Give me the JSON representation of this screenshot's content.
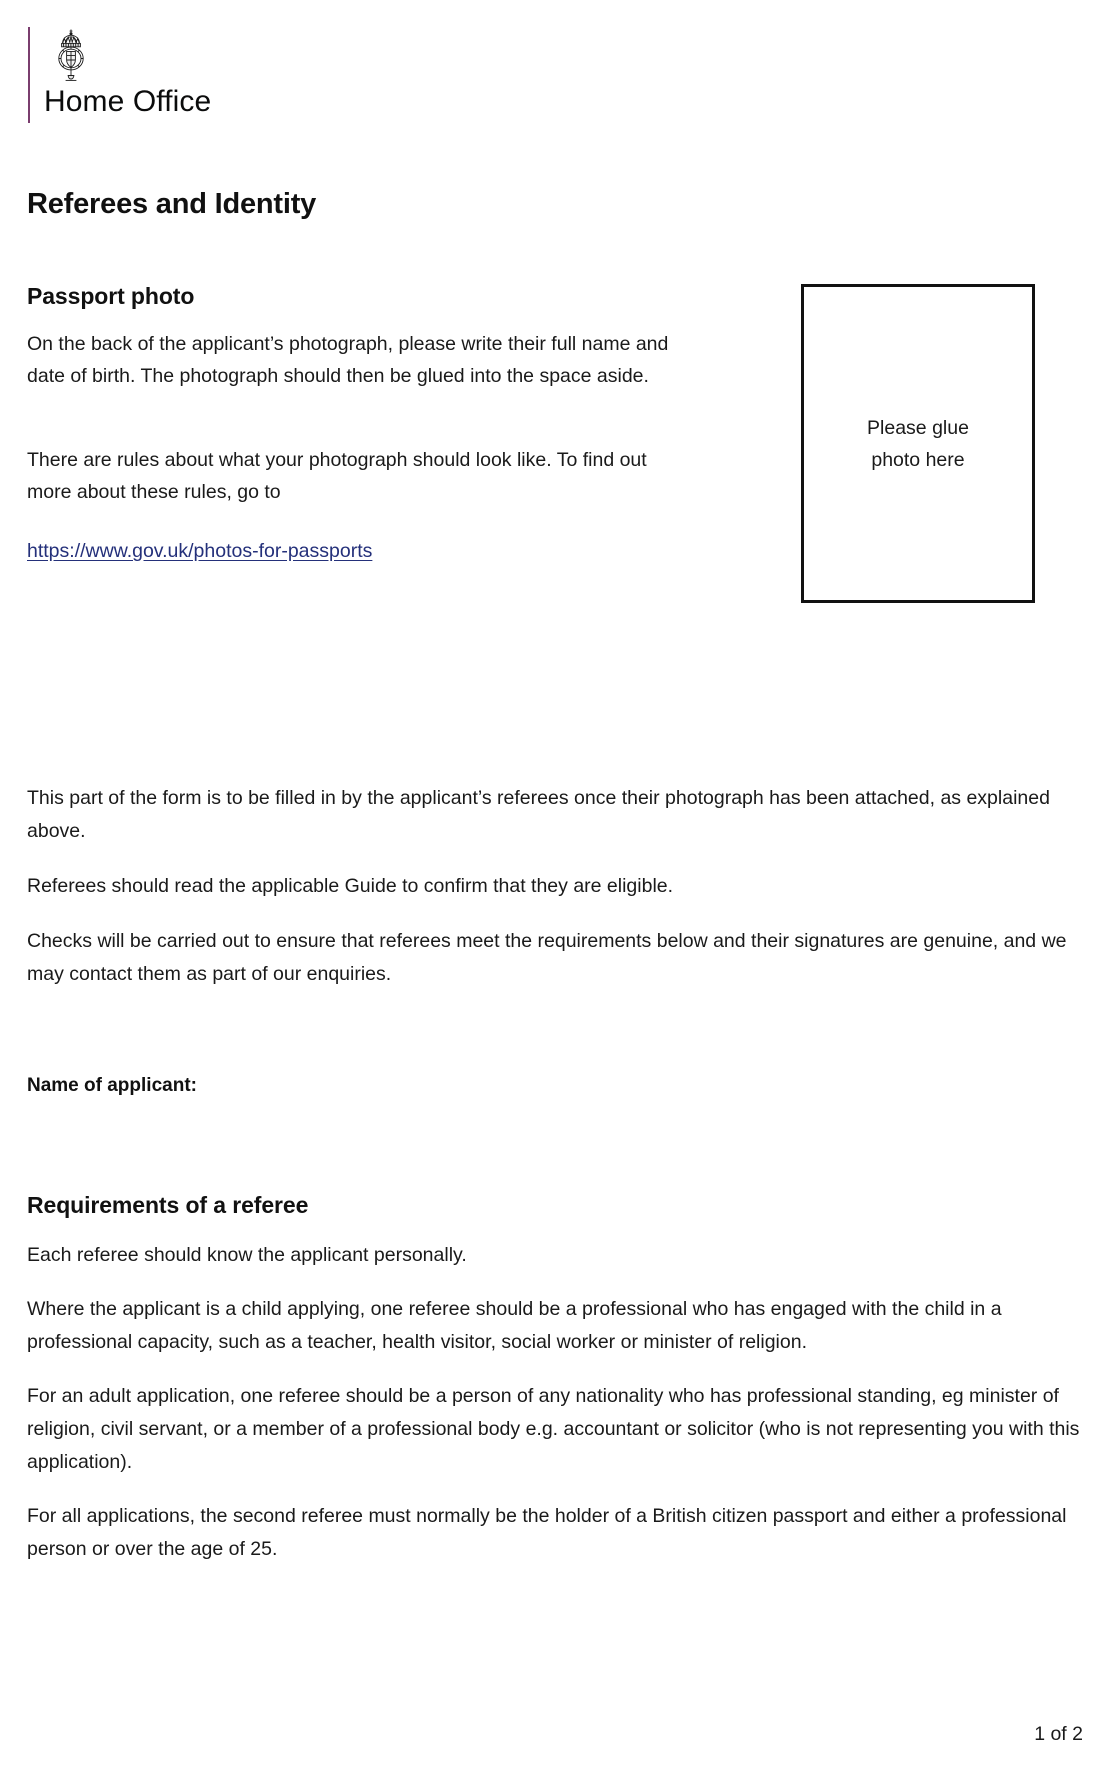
{
  "masthead": {
    "crest_icon": "royal-crest-icon",
    "brand_name": "Home Office",
    "rule_color": "#7a3d6e"
  },
  "document": {
    "title": "Referees and Identity",
    "footer": "1 of 2"
  },
  "passport_photo": {
    "heading": "Passport photo",
    "paragraph_1": "On the back of the applicant’s photograph, please write their full name and date of birth. The photograph should then be glued into the space aside.",
    "paragraph_2": "There are rules about what your photograph should look like. To find out more about these rules, go to",
    "link_text": "https://www.gov.uk/photos-for-passports",
    "link_color": "#24307a",
    "photo_box_label_line_1": "Please glue",
    "photo_box_label_line_2": "photo here"
  },
  "intro": {
    "paragraph_1": "This part of the form is to be filled in by the applicant’s referees once their photograph has been attached, as explained above.",
    "paragraph_2": "Referees should read the applicable Guide to confirm that they are eligible.",
    "paragraph_3": "Checks will be carried out to ensure that referees meet the requirements below and their signatures are genuine, and we may contact them as part of our enquiries."
  },
  "applicant": {
    "name_label": "Name of applicant:"
  },
  "requirements": {
    "heading": "Requirements of a referee",
    "paragraph_1": "Each referee should know the applicant personally.",
    "paragraph_2": "Where the applicant is a child applying, one referee should be a professional who has engaged with the child in a professional capacity, such as a teacher, health visitor, social worker or minister of religion.",
    "paragraph_3": "For an adult application, one referee should be a person of any nationality who has professional standing, eg minister of religion, civil servant, or a member of a professional body e.g. accountant or solicitor (who is not representing you with this application).",
    "paragraph_4": "For all applications, the second referee must normally be the holder of a British citizen passport and either a professional person or over the age of 25."
  }
}
